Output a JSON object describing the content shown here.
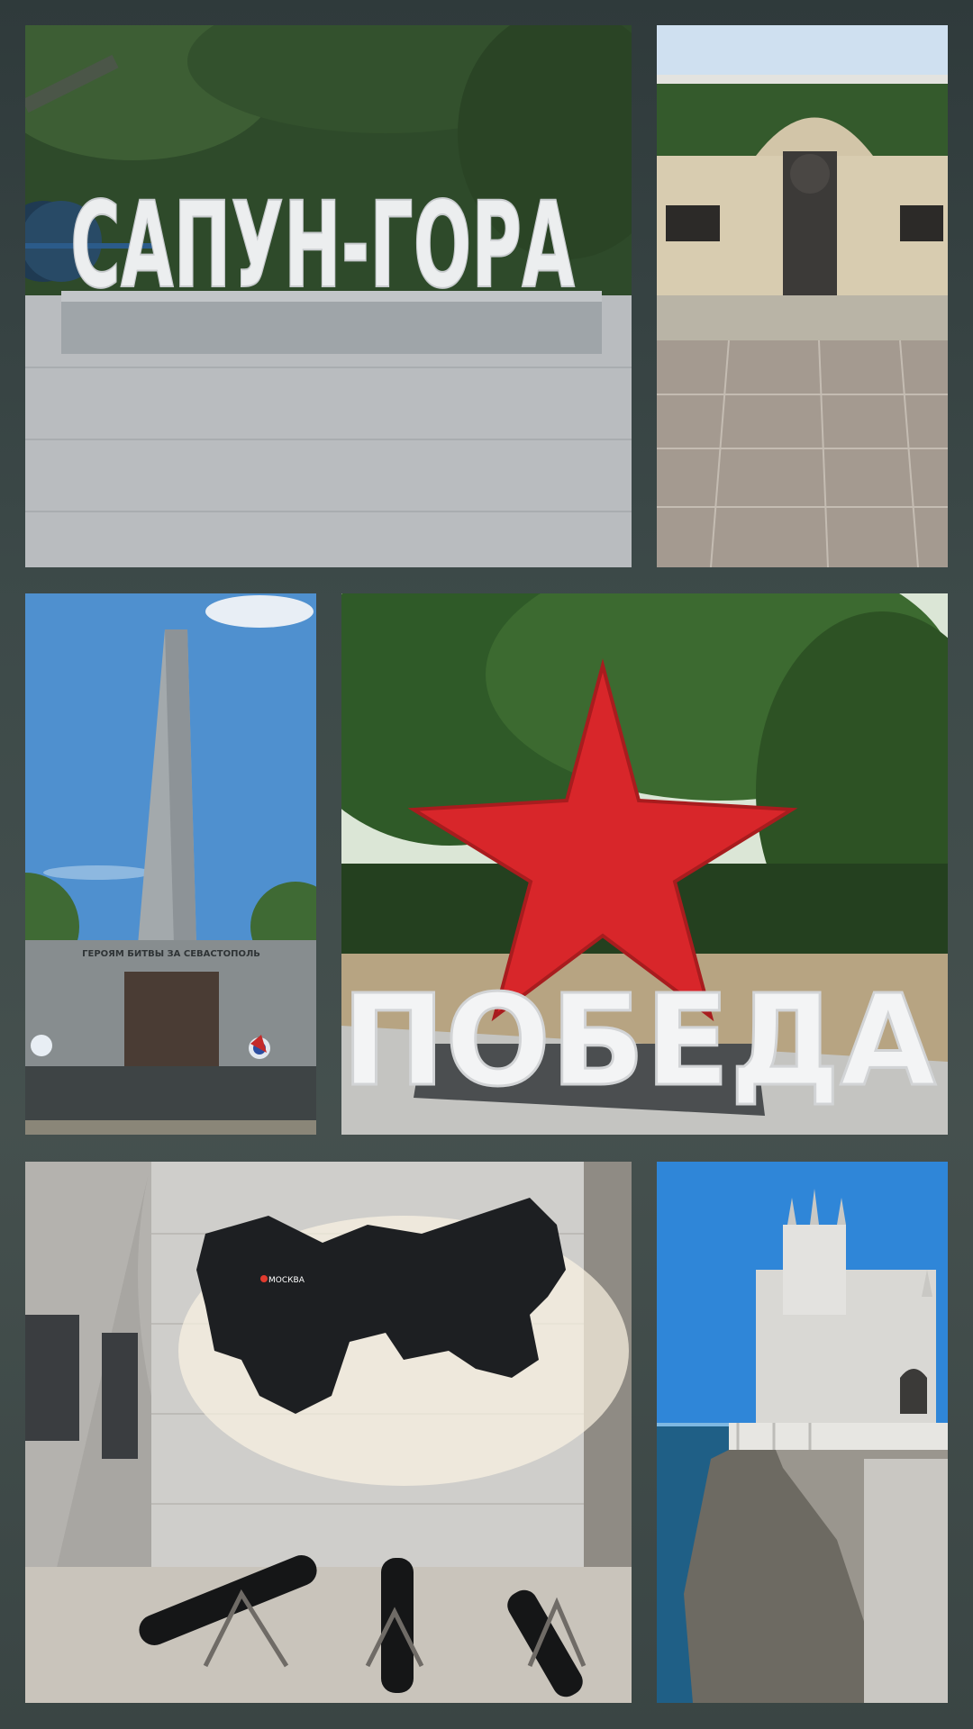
{
  "collage": {
    "background": "#3b4645",
    "tiles": [
      {
        "subject": "sapun-gora-sign",
        "sign_text": "САПУН-ГОРА"
      },
      {
        "subject": "memorial-wall"
      },
      {
        "subject": "obelisk",
        "inscription": "ГЕРОЯМ БИТВЫ ЗА СЕВАСТОПОЛЬ"
      },
      {
        "subject": "pobeda-sign",
        "sign_text": "ПОБЕДА",
        "star_color": "#d8262a"
      },
      {
        "subject": "bunker-map-exhibit",
        "map_label": "МОСКВА"
      },
      {
        "subject": "swallows-nest-castle"
      }
    ]
  }
}
